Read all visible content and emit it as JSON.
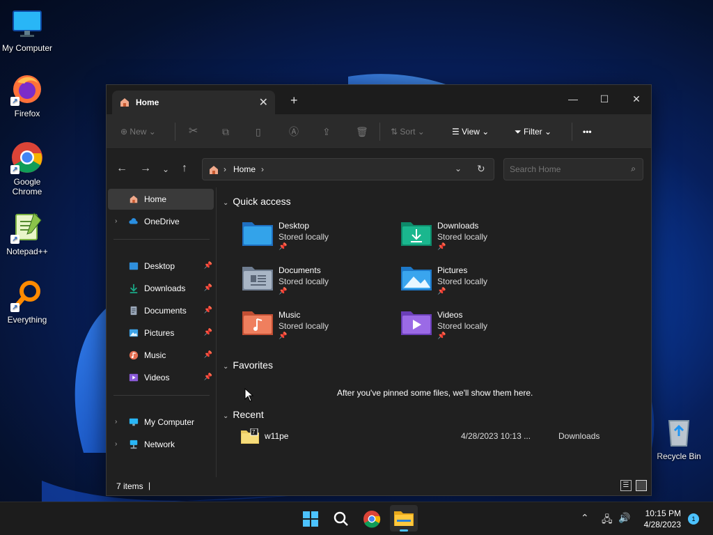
{
  "desktop": {
    "icons": [
      {
        "label": "My Computer",
        "icon": "monitor-icon"
      },
      {
        "label": "Firefox",
        "icon": "firefox-icon"
      },
      {
        "label": "Google Chrome",
        "icon": "chrome-icon"
      },
      {
        "label": "Notepad++",
        "icon": "notepadpp-icon"
      },
      {
        "label": "Everything",
        "icon": "search-icon"
      },
      {
        "label": "Recycle Bin",
        "icon": "recycle-bin-icon"
      }
    ]
  },
  "window": {
    "tab_title": "Home",
    "new_tab": "+",
    "controls": {
      "minimize": "—",
      "maximize": "☐",
      "close": "✕"
    },
    "toolbar": {
      "new_label": "New",
      "sort_label": "Sort",
      "view_label": "View",
      "filter_label": "Filter",
      "more_label": "•••"
    },
    "address": {
      "location": "Home"
    },
    "search": {
      "placeholder": "Search Home"
    },
    "sidebar": {
      "home": "Home",
      "onedrive": "OneDrive",
      "pinned": [
        {
          "label": "Desktop",
          "color": "#2f8fdc"
        },
        {
          "label": "Downloads",
          "color": "#1aa886"
        },
        {
          "label": "Documents",
          "color": "#9aa7b8"
        },
        {
          "label": "Pictures",
          "color": "#3da3e8"
        },
        {
          "label": "Music",
          "color": "#e46f52"
        },
        {
          "label": "Videos",
          "color": "#8a5ad8"
        }
      ],
      "my_computer": "My Computer",
      "network": "Network"
    },
    "quick_access": {
      "heading": "Quick access",
      "items": [
        {
          "name": "Desktop",
          "sub": "Stored locally",
          "color": "#2f8fdc"
        },
        {
          "name": "Downloads",
          "sub": "Stored locally",
          "color": "#1aa886"
        },
        {
          "name": "Documents",
          "sub": "Stored locally",
          "color": "#9aa7b8"
        },
        {
          "name": "Pictures",
          "sub": "Stored locally",
          "color": "#3da3e8"
        },
        {
          "name": "Music",
          "sub": "Stored locally",
          "color": "#e46f52"
        },
        {
          "name": "Videos",
          "sub": "Stored locally",
          "color": "#8a5ad8"
        }
      ]
    },
    "favorites": {
      "heading": "Favorites",
      "empty_text": "After you've pinned some files, we'll show them here."
    },
    "recent": {
      "heading": "Recent",
      "files": [
        {
          "name": "w11pe",
          "date": "4/28/2023 10:13 ...",
          "location": "Downloads"
        }
      ]
    },
    "status": {
      "count": "7 items"
    }
  },
  "taskbar": {
    "time": "10:15 PM",
    "date": "4/28/2023",
    "notifications": "1"
  }
}
